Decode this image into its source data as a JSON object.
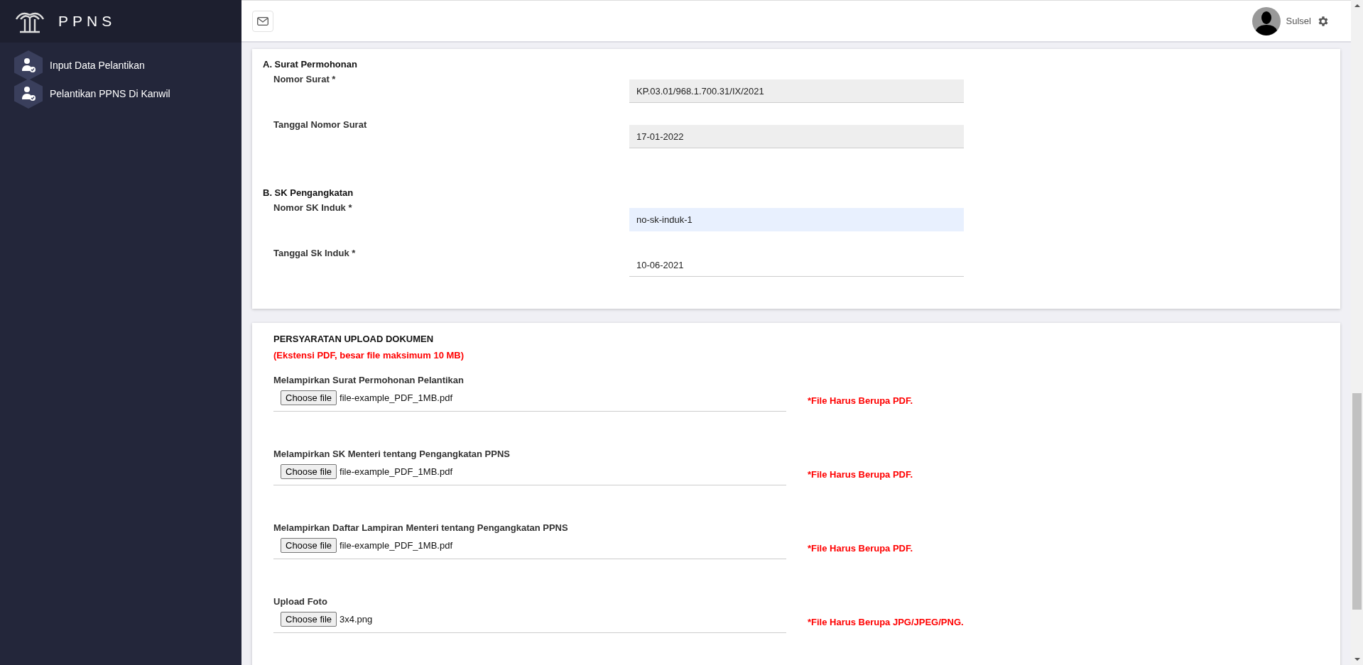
{
  "sidebar": {
    "brand": "PPNS",
    "items": [
      {
        "label": "Input Data Pelantikan"
      },
      {
        "label": "Pelantikan PPNS Di Kanwil"
      }
    ]
  },
  "header": {
    "user_name": "Sulsel"
  },
  "sections": [
    {
      "title": "A. Surat Permohonan",
      "fields": [
        {
          "label": "Nomor Surat *",
          "value": "KP.03.01/968.1.700.31/IX/2021",
          "kind": "readonly"
        },
        {
          "label": "Tanggal Nomor Surat",
          "value": "17-01-2022",
          "kind": "readonly"
        }
      ]
    },
    {
      "title": "B. SK Pengangkatan",
      "fields": [
        {
          "label": "Nomor SK Induk *",
          "value": "no-sk-induk-1",
          "kind": "autofill"
        },
        {
          "label": "Tanggal Sk Induk *",
          "value": "10-06-2021",
          "kind": "plain"
        }
      ]
    }
  ],
  "uploads": {
    "title": "PERSYARATAN UPLOAD DOKUMEN",
    "note": "(Ekstensi PDF, besar file maksimum 10 MB)",
    "items": [
      {
        "label": "Melampirkan Surat Permohonan Pelantikan",
        "button": "Choose file",
        "file": "file-example_PDF_1MB.pdf",
        "hint": "*File Harus Berupa PDF."
      },
      {
        "label": "Melampirkan SK Menteri tentang Pengangkatan PPNS",
        "button": "Choose file",
        "file": "file-example_PDF_1MB.pdf",
        "hint": "*File Harus Berupa PDF."
      },
      {
        "label": "Melampirkan Daftar Lampiran Menteri tentang Pengangkatan PPNS",
        "button": "Choose file",
        "file": "file-example_PDF_1MB.pdf",
        "hint": "*File Harus Berupa PDF."
      },
      {
        "label": "Upload Foto",
        "button": "Choose file",
        "file": "3x4.png",
        "hint": "*File Harus Berupa JPG/JPEG/PNG."
      }
    ]
  }
}
